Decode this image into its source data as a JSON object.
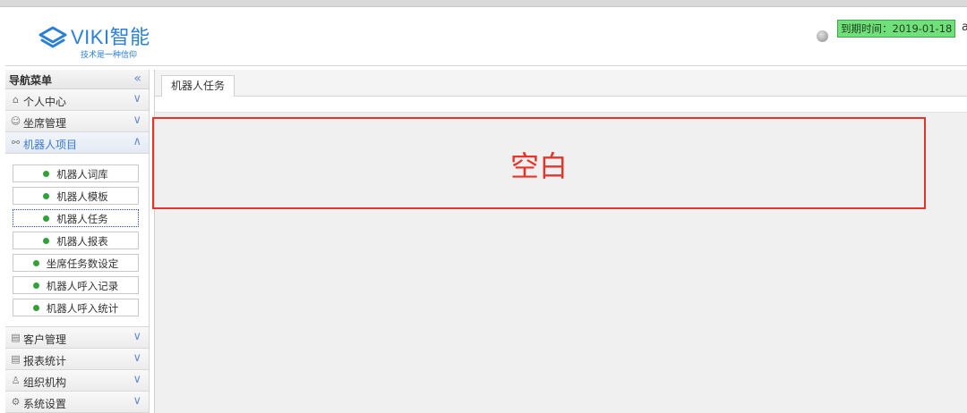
{
  "header": {
    "logo_title": "VIKI智能",
    "logo_slogan": "技术是一种信仰",
    "expire_label": "到期时间：2019-01-18",
    "user_name": "a"
  },
  "sidebar": {
    "title": "导航菜单",
    "collapse_icon": "«",
    "menus": [
      {
        "label": "个人中心",
        "icon": "home-icon"
      },
      {
        "label": "坐席管理",
        "icon": "user-icon"
      },
      {
        "label": "机器人项目",
        "icon": "users-icon"
      },
      {
        "label": "客户管理",
        "icon": "customer-icon"
      },
      {
        "label": "报表统计",
        "icon": "report-icon"
      },
      {
        "label": "组织机构",
        "icon": "org-icon"
      },
      {
        "label": "系统设置",
        "icon": "settings-icon"
      }
    ],
    "robot_items": [
      "机器人词库",
      "机器人模板",
      "机器人任务",
      "机器人报表",
      "坐席任务数设定",
      "机器人呼入记录",
      "机器人呼入统计"
    ]
  },
  "main": {
    "active_tab": "机器人任务",
    "empty_text": "空白"
  },
  "colors": {
    "accent": "#2b7fd6",
    "badge_bg": "#71e07a",
    "highlight_red": "#e4352a",
    "bullet_green": "#33a13a"
  }
}
